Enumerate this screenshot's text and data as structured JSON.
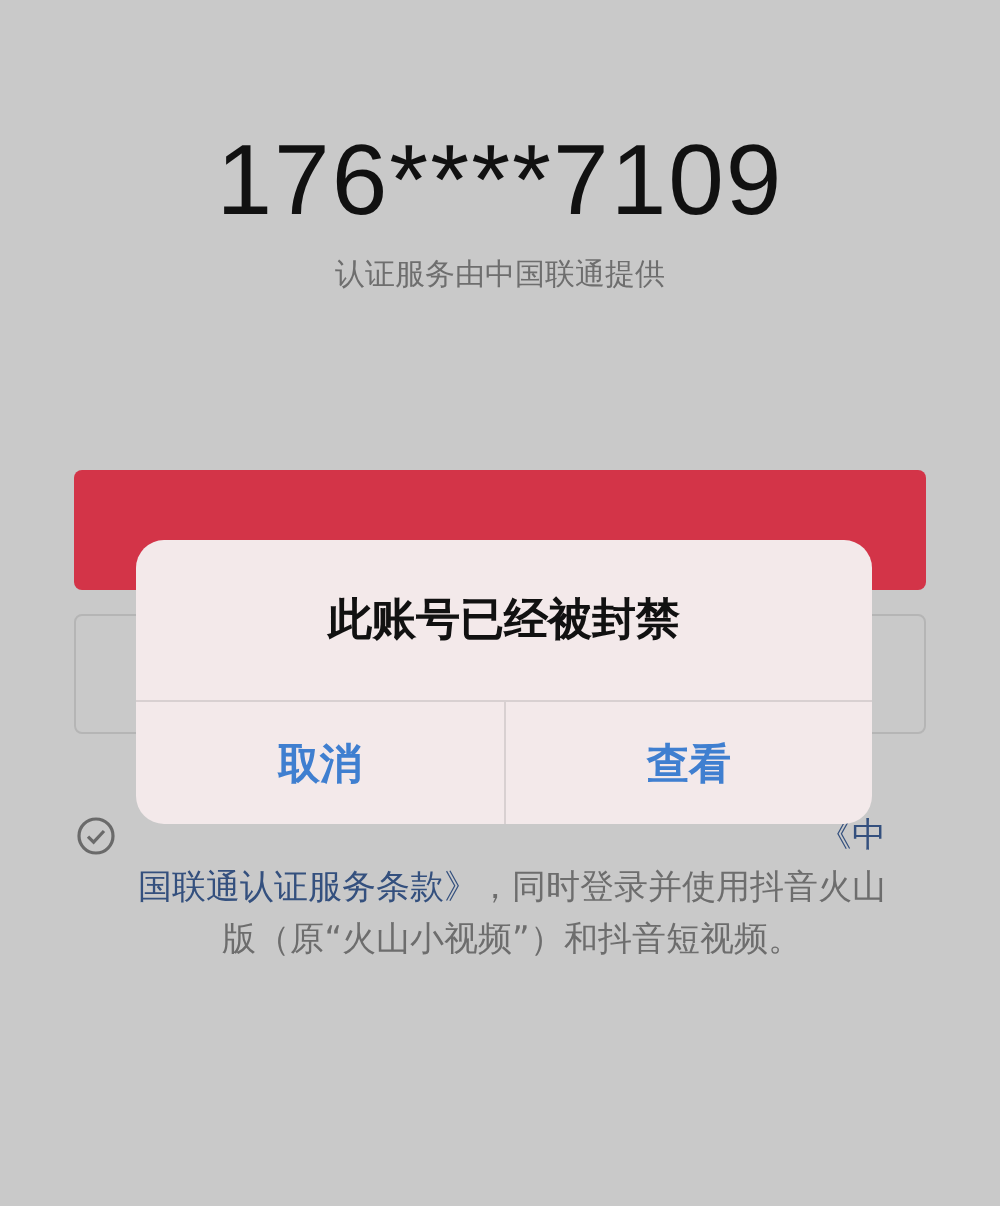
{
  "phone_number": "176****7109",
  "provider_note": "认证服务由中国联通提供",
  "agreement": {
    "checked": true,
    "segments": [
      {
        "kind": "link",
        "text": "《中"
      },
      {
        "kind": "link",
        "text": "国联通认证服务条款》"
      },
      {
        "kind": "plain",
        "text": "，同时登录并使用抖音火山版（原“火山小视频”）和抖音短视频。"
      }
    ]
  },
  "dialog": {
    "title": "此账号已经被封禁",
    "buttons": [
      {
        "label": "取消"
      },
      {
        "label": "查看"
      }
    ]
  }
}
